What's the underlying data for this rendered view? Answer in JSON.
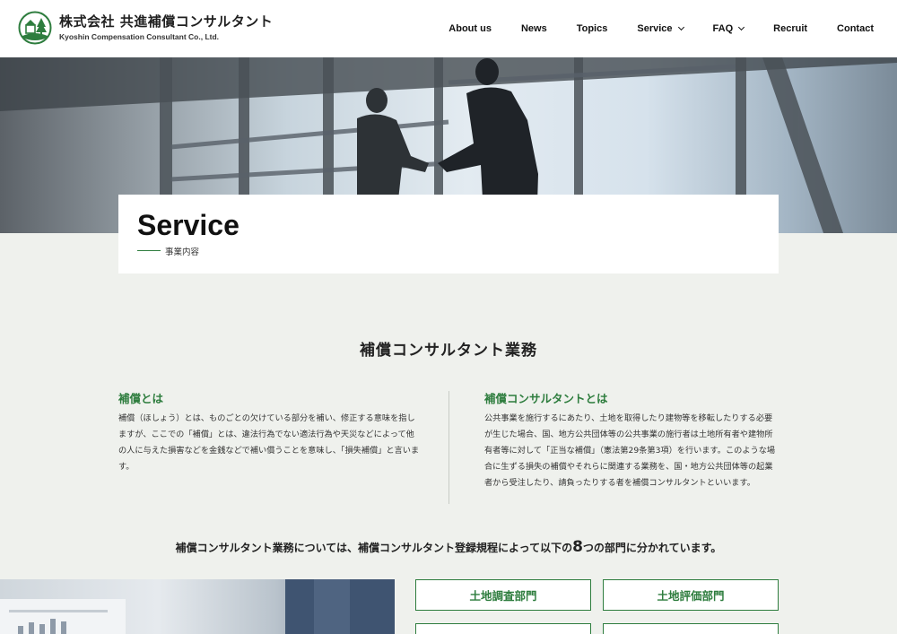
{
  "header": {
    "company_ja": "株式会社 共進補償コンサルタント",
    "company_en": "Kyoshin Compensation Consultant Co., Ltd.",
    "nav": [
      {
        "label": "About us"
      },
      {
        "label": "News"
      },
      {
        "label": "Topics"
      },
      {
        "label": "Service",
        "dropdown": true
      },
      {
        "label": "FAQ",
        "dropdown": true
      },
      {
        "label": "Recruit"
      },
      {
        "label": "Contact"
      }
    ]
  },
  "page": {
    "title": "Service",
    "subtitle": "事業内容"
  },
  "section": {
    "heading": "補償コンサルタント業務",
    "left": {
      "title": "補償とは",
      "body": "補償（ほしょう）とは、ものごとの欠けている部分を補い、修正する意味を指しますが、ここでの「補償」とは、違法行為でない適法行為や天災などによって他の人に与えた損害などを金銭などで補い償うことを意味し、「損失補償」と言います。"
    },
    "right": {
      "title": "補償コンサルタントとは",
      "body": "公共事業を施行するにあたり、土地を取得したり建物等を移転したりする必要が生じた場合、国、地方公共団体等の公共事業の施行者は土地所有者や建物所有者等に対して「正当な補償」（憲法第29条第3項）を行います。このような場合に生ずる損失の補償やそれらに関連する業務を、国・地方公共団体等の起業者から受注したり、請負ったりする者を補償コンサルタントといいます。"
    },
    "lead_before": "補償コンサルタント業務については、補償コンサルタント登録規程によって以下の",
    "lead_number": "8",
    "lead_after": "つの部門に分かれています。"
  },
  "departments": [
    {
      "label": "土地調査部門"
    },
    {
      "label": "土地評価部門"
    },
    {
      "label": ""
    },
    {
      "label": ""
    }
  ],
  "colors": {
    "accent": "#2e7d3e",
    "background": "#eff1ed"
  }
}
